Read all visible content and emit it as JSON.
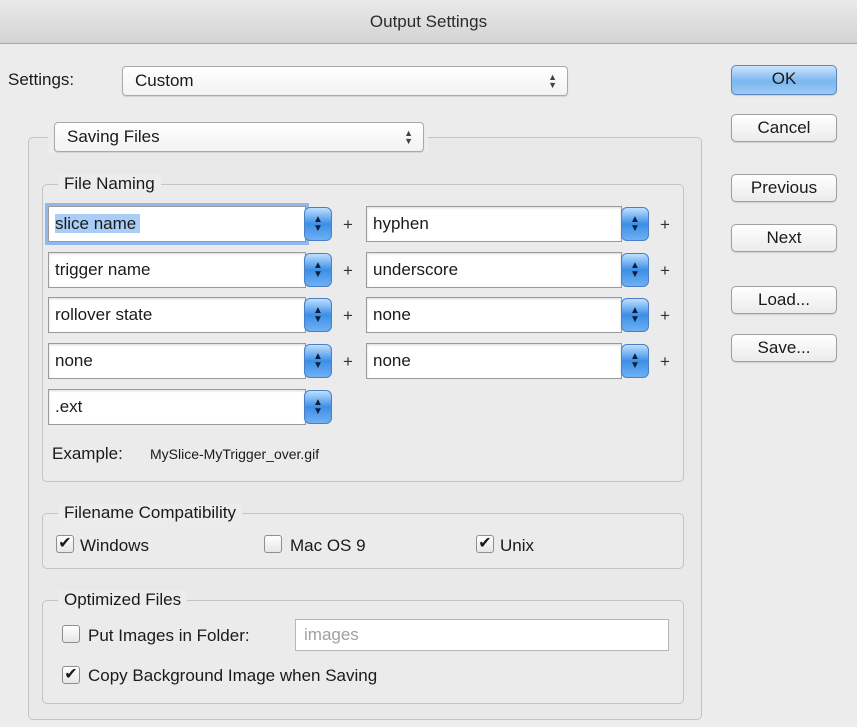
{
  "window": {
    "title": "Output Settings"
  },
  "settings": {
    "label": "Settings:",
    "value": "Custom"
  },
  "section_popup": {
    "value": "Saving Files"
  },
  "buttons": {
    "ok": "OK",
    "cancel": "Cancel",
    "previous": "Previous",
    "next": "Next",
    "load": "Load...",
    "save": "Save..."
  },
  "file_naming": {
    "legend": "File Naming",
    "plus": "+",
    "rows": [
      {
        "left": "slice name",
        "right": "hyphen"
      },
      {
        "left": "trigger name",
        "right": "underscore"
      },
      {
        "left": "rollover state",
        "right": "none"
      },
      {
        "left": "none",
        "right": "none"
      }
    ],
    "ext": ".ext",
    "example_label": "Example:",
    "example_value": "MySlice-MyTrigger_over.gif"
  },
  "compatibility": {
    "legend": "Filename Compatibility",
    "windows": {
      "label": "Windows",
      "checked": true
    },
    "macos9": {
      "label": "Mac OS 9",
      "checked": false
    },
    "unix": {
      "label": "Unix",
      "checked": true
    }
  },
  "optimized": {
    "legend": "Optimized Files",
    "put_images": {
      "label": "Put Images in Folder:",
      "checked": false
    },
    "folder_placeholder": "images",
    "copy_background": {
      "label": "Copy Background Image when Saving",
      "checked": true
    }
  },
  "icons": {
    "checkmark": "✔",
    "updown": "▲▼"
  }
}
